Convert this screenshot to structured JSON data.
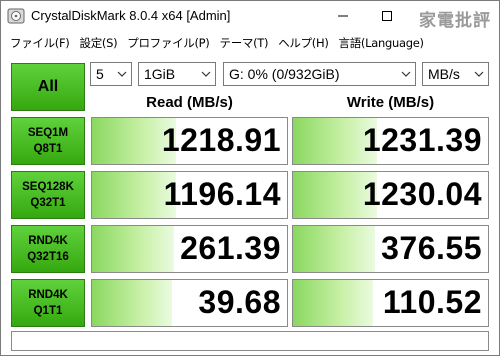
{
  "window": {
    "title": "CrystalDiskMark 8.0.4 x64 [Admin]"
  },
  "watermark": "家電批評",
  "menu": [
    "ファイル(F)",
    "設定(S)",
    "プロファイル(P)",
    "テーマ(T)",
    "ヘルプ(H)",
    "言語(Language)"
  ],
  "controls": {
    "all_label": "All",
    "count": "5",
    "size": "1GiB",
    "drive": "G: 0% (0/932GiB)",
    "unit": "MB/s"
  },
  "columns": {
    "read": "Read (MB/s)",
    "write": "Write (MB/s)"
  },
  "tests": [
    {
      "label1": "SEQ1M",
      "label2": "Q8T1",
      "read": "1218.91",
      "write": "1231.39",
      "read_fill": 0.43,
      "write_fill": 0.43
    },
    {
      "label1": "SEQ128K",
      "label2": "Q32T1",
      "read": "1196.14",
      "write": "1230.04",
      "read_fill": 0.43,
      "write_fill": 0.43
    },
    {
      "label1": "RND4K",
      "label2": "Q32T16",
      "read": "261.39",
      "write": "376.55",
      "read_fill": 0.42,
      "write_fill": 0.42
    },
    {
      "label1": "RND4K",
      "label2": "Q1T1",
      "read": "39.68",
      "write": "110.52",
      "read_fill": 0.41,
      "write_fill": 0.41
    }
  ],
  "comment": "",
  "colors": {
    "accent": "#36a80f",
    "bar": "#8ad860"
  }
}
